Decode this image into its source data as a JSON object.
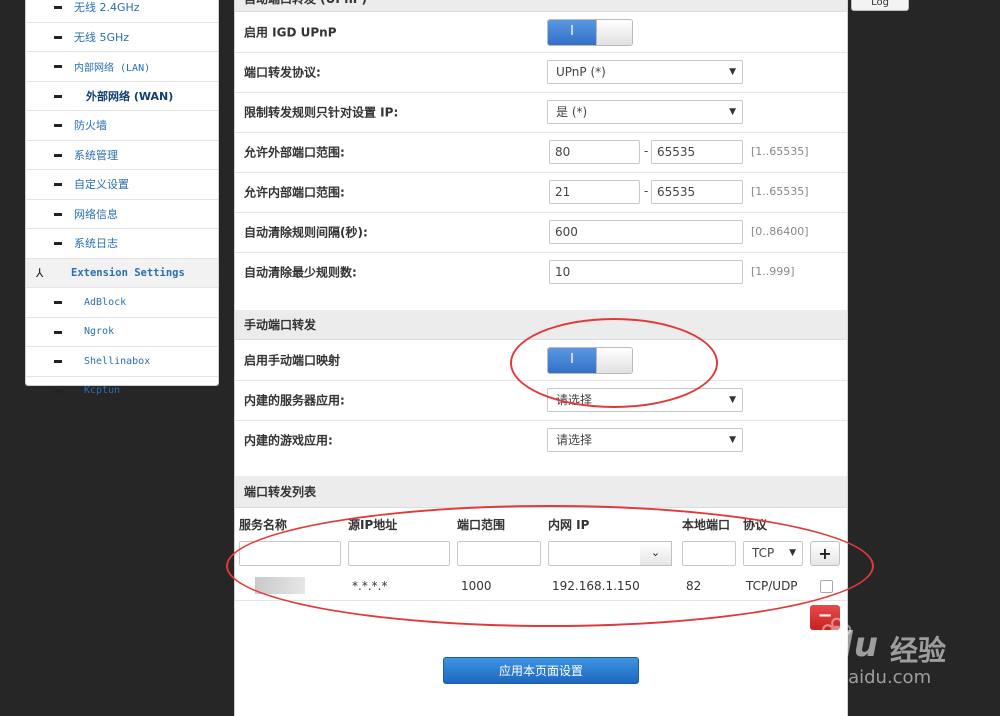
{
  "sidebar": {
    "items": [
      {
        "label": "无线 2.4GHz",
        "type": "normal"
      },
      {
        "label": "无线 5GHz",
        "type": "normal"
      },
      {
        "label": "内部网络 (LAN)",
        "type": "latin"
      },
      {
        "label": "外部网络 (WAN)",
        "type": "active"
      },
      {
        "label": "防火墙",
        "type": "normal"
      },
      {
        "label": "系统管理",
        "type": "normal"
      },
      {
        "label": "自定义设置",
        "type": "normal"
      },
      {
        "label": "网络信息",
        "type": "normal"
      },
      {
        "label": "系统日志",
        "type": "normal"
      },
      {
        "label": "Extension Settings",
        "type": "ext"
      },
      {
        "label": "AdBlock",
        "type": "sub"
      },
      {
        "label": "Ngrok",
        "type": "sub"
      },
      {
        "label": "Shellinabox",
        "type": "sub"
      },
      {
        "label": "Kcptun",
        "type": "sub"
      }
    ]
  },
  "top_button": {
    "label": "Log"
  },
  "upnp_section": {
    "title": "自动端口转发 (UPnP)",
    "enable_label": "启用 IGD UPnP",
    "enable_toggle": "I",
    "protocol_label": "端口转发协议:",
    "protocol_value": "UPnP (*)",
    "restrict_label": "限制转发规则只针对设置 IP:",
    "restrict_value": "是 (*)",
    "ext_range_label": "允许外部端口范围:",
    "ext_range_from": "80",
    "ext_range_to": "65535",
    "ext_range_hint": "[1..65535]",
    "int_range_label": "允许内部端口范围:",
    "int_range_from": "21",
    "int_range_to": "65535",
    "int_range_hint": "[1..65535]",
    "clean_interval_label": "自动清除规则间隔(秒):",
    "clean_interval_value": "600",
    "clean_interval_hint": "[0..86400]",
    "clean_min_label": "自动清除最少规则数:",
    "clean_min_value": "10",
    "clean_min_hint": "[1..999]",
    "dash": "-"
  },
  "manual_section": {
    "title": "手动端口转发",
    "enable_label": "启用手动端口映射",
    "enable_toggle": "I",
    "server_app_label": "内建的服务器应用:",
    "server_app_value": "请选择",
    "game_app_label": "内建的游戏应用:",
    "game_app_value": "请选择"
  },
  "forward_list": {
    "title": "端口转发列表",
    "columns": [
      "服务名称",
      "源IP地址",
      "端口范围",
      "内网 IP",
      "本地端口",
      "协议"
    ],
    "new_row": {
      "protocol": "TCP",
      "add_label": "+"
    },
    "rows": [
      {
        "src_ip": "*.*.*.*",
        "port_range": "1000",
        "lan_ip": "192.168.1.150",
        "local_port": "82",
        "protocol": "TCP/UDP"
      }
    ],
    "remove_label": "−"
  },
  "apply_button": {
    "label": "应用本页面设置"
  },
  "watermark": {
    "brand": "Baidu",
    "suffix": "经验",
    "url": "jingyan.baidu.com"
  }
}
